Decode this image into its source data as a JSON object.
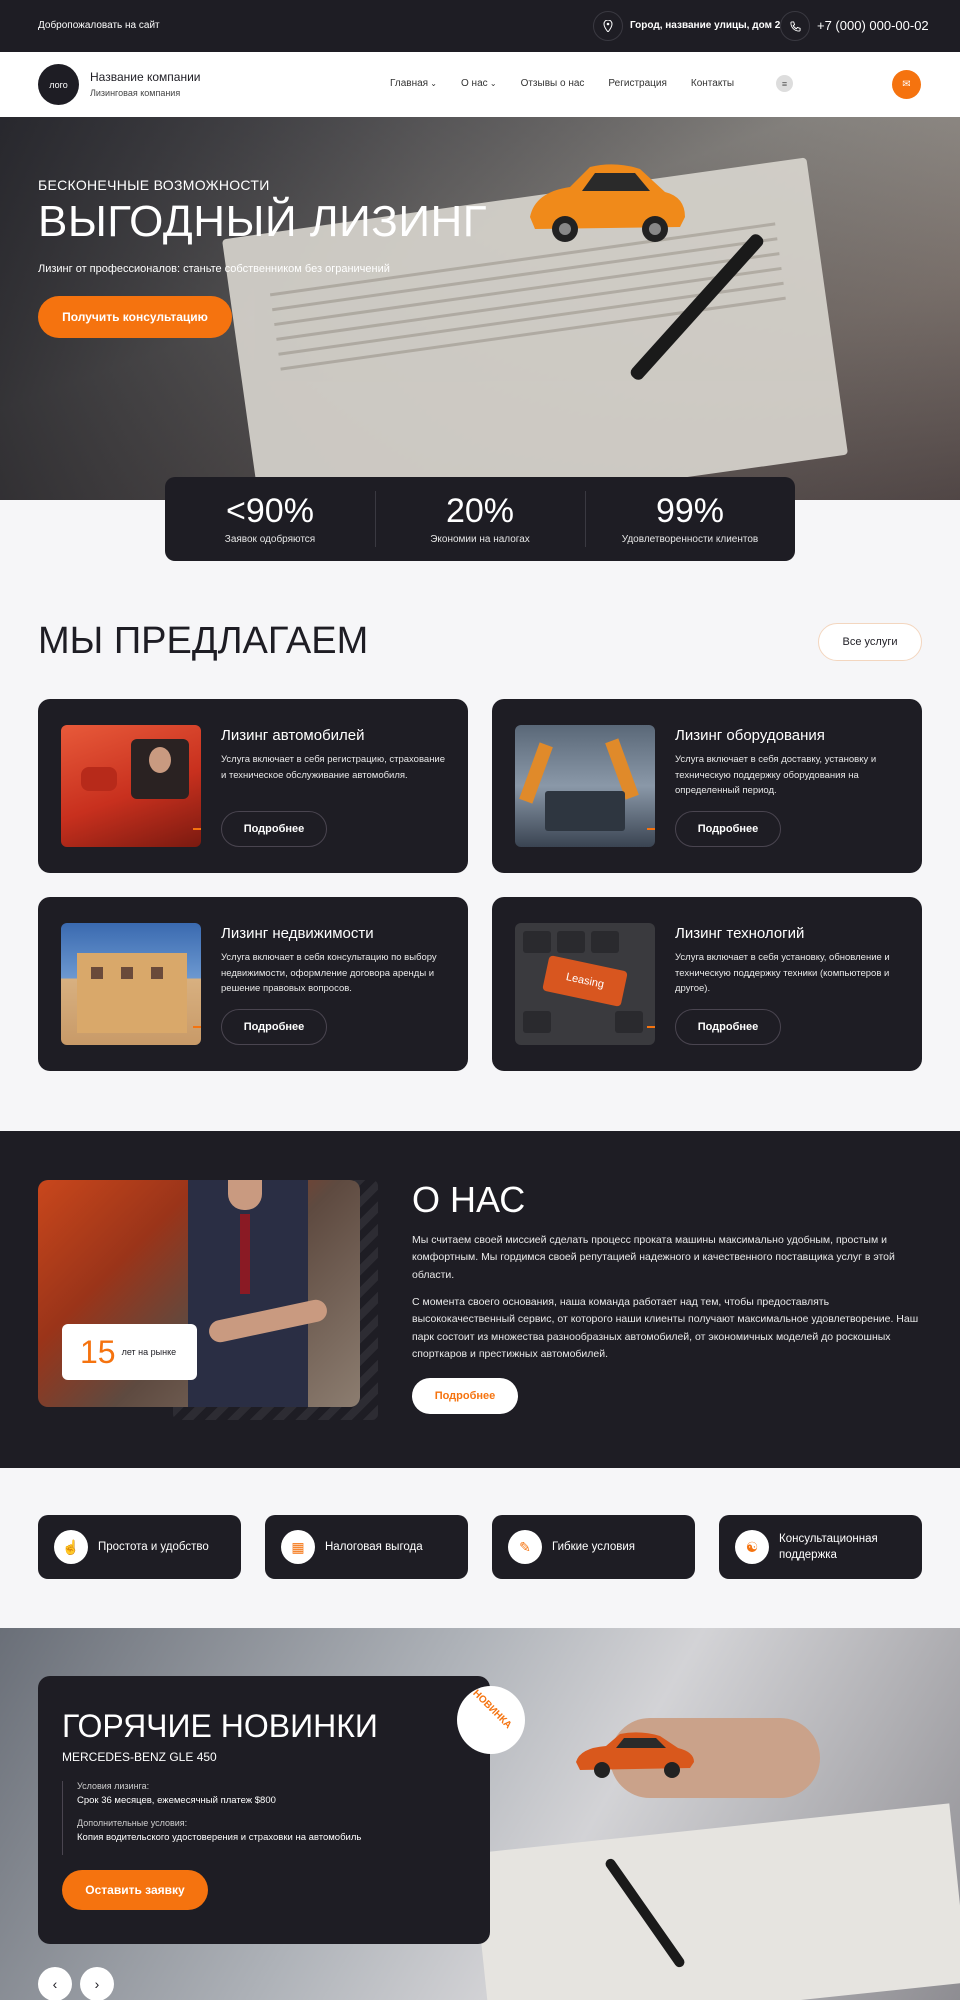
{
  "topbar": {
    "welcome": "Добропожаловать на сайт",
    "address": "Город, название улицы, дом 2",
    "phone": "+7 (000) 000-00-02"
  },
  "nav": {
    "logo": "лого",
    "company_name": "Название компании",
    "company_sub": "Лизинговая компания",
    "items": [
      {
        "label": "Главная",
        "dropdown": true
      },
      {
        "label": "О нас",
        "dropdown": true
      },
      {
        "label": "Отзывы о нас",
        "dropdown": false
      },
      {
        "label": "Регистрация",
        "dropdown": false
      },
      {
        "label": "Контакты",
        "dropdown": false
      }
    ]
  },
  "hero": {
    "kicker": "БЕСКОНЕЧНЫЕ ВОЗМОЖНОСТИ",
    "title": "ВЫГОДНЫЙ ЛИЗИНГ",
    "subtitle": "Лизинг от профессионалов: станьте собственником без ограничений",
    "button": "Получить консультацию"
  },
  "stats": [
    {
      "value": "<90%",
      "label": "Заявок одобряются"
    },
    {
      "value": "20%",
      "label": "Экономии на налогах"
    },
    {
      "value": "99%",
      "label": "Удовлетворенности клиентов"
    }
  ],
  "offers": {
    "title": "МЫ ПРЕДЛАГАЕМ",
    "all_button": "Все услуги",
    "more_label": "Подробнее",
    "cards": [
      {
        "title": "Лизинг автомобилей",
        "text": "Услуга включает в себя регистрацию, страхование и техническое обслуживание автомобиля."
      },
      {
        "title": "Лизинг оборудования",
        "text": "Услуга включает в себя доставку, установку и техническую поддержку оборудования на определенный период."
      },
      {
        "title": "Лизинг недвижимости",
        "text": "Услуга включает в себя консультацию по выбору недвижимости, оформление договора аренды и решение правовых вопросов."
      },
      {
        "title": "Лизинг технологий",
        "text": "Услуга включает в себя установку, обновление и техническую поддержку техники (компьютеров и другое)."
      }
    ],
    "keyboard_key": "Leasing"
  },
  "about": {
    "title": "О НАС",
    "p1": "Мы считаем своей миссией сделать процесс проката машины максимально удобным, простым и комфортным. Мы гордимся своей репутацией надежного и качественного поставщика услуг в этой области.",
    "p2": "С момента своего основания, наша команда работает над тем, чтобы предоставлять высококачественный сервис, от которого наши клиенты получают максимальное удовлетворение. Наш парк состоит из множества разнообразных автомобилей, от экономичных моделей до роскошных спорткаров и престижных автомобилей.",
    "button": "Подробнее",
    "years_value": "15",
    "years_label": "лет на рынке"
  },
  "features": [
    {
      "label": "Простота и удобство",
      "icon": "hand-click-icon"
    },
    {
      "label": "Налоговая выгода",
      "icon": "calculator-icon"
    },
    {
      "label": "Гибкие условия",
      "icon": "document-icon"
    },
    {
      "label": "Консультационная поддержка",
      "icon": "handshake-icon"
    }
  ],
  "hot": {
    "title": "ГОРЯЧИЕ НОВИНКИ",
    "model": "MERCEDES-BENZ GLE 450",
    "terms_label": "Условия лизинга:",
    "terms_value": "Срок 36 месяцев, ежемесячный платеж $800",
    "extra_label": "Дополнительные условия:",
    "extra_value": "Копия водительского удостоверения и страховки на автомобиль",
    "button": "Оставить заявку",
    "badge": "НОВИНКА"
  },
  "colors": {
    "accent": "#f5730f",
    "dark": "#1e1d24",
    "light_bg": "#f6f6f8"
  }
}
